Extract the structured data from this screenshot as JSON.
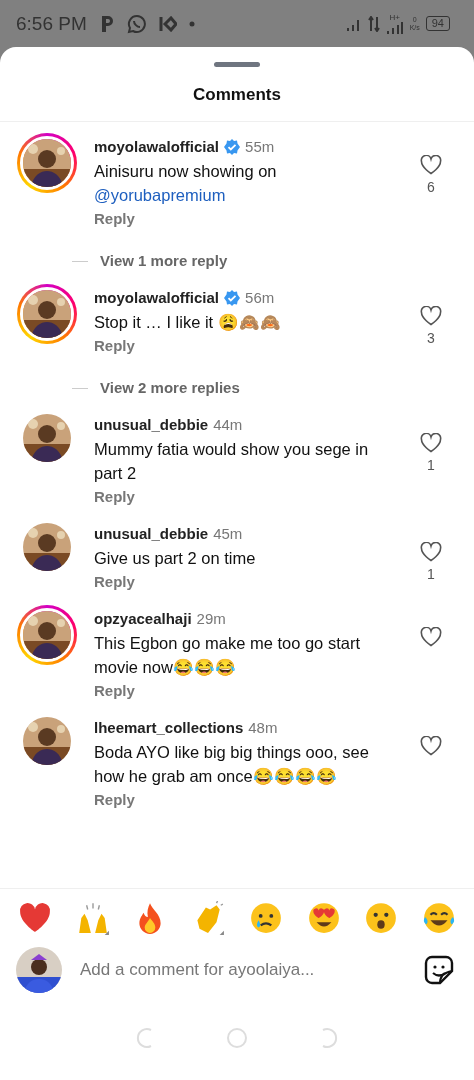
{
  "status_bar": {
    "time": "6:56 PM",
    "network_type": "H+",
    "speed_value": "0",
    "speed_unit": "K/s",
    "battery": "94"
  },
  "sheet": {
    "title": "Comments"
  },
  "comments": [
    {
      "username": "moyolawalofficial",
      "verified": true,
      "story_ring": true,
      "time": "55m",
      "text": "Ainisuru now showing on",
      "mention": "@yorubapremium",
      "reply": "Reply",
      "likes": "6",
      "view_more": "View 1 more reply"
    },
    {
      "username": "moyolawalofficial",
      "verified": true,
      "story_ring": true,
      "time": "56m",
      "text": "Stop it … I like it 😩🙈🙈",
      "reply": "Reply",
      "likes": "3",
      "view_more": "View 2 more replies"
    },
    {
      "username": "unusual_debbie",
      "verified": false,
      "story_ring": false,
      "time": "44m",
      "text": "Mummy fatia would show you sege in part 2",
      "reply": "Reply",
      "likes": "1"
    },
    {
      "username": "unusual_debbie",
      "verified": false,
      "story_ring": false,
      "time": "45m",
      "text": "Give us part 2 on time",
      "reply": "Reply",
      "likes": "1"
    },
    {
      "username": "opzyacealhaji",
      "verified": false,
      "story_ring": true,
      "time": "29m",
      "text": "This Egbon go make me too go start movie now😂😂😂",
      "reply": "Reply"
    },
    {
      "username": "lheemart_collections",
      "verified": false,
      "story_ring": false,
      "time": "48m",
      "text": "Boda AYO like big big things ooo, see how he grab am once😂😂😂😂",
      "reply": "Reply"
    }
  ],
  "composer": {
    "placeholder": "Add a comment for ayoolaiya..."
  }
}
